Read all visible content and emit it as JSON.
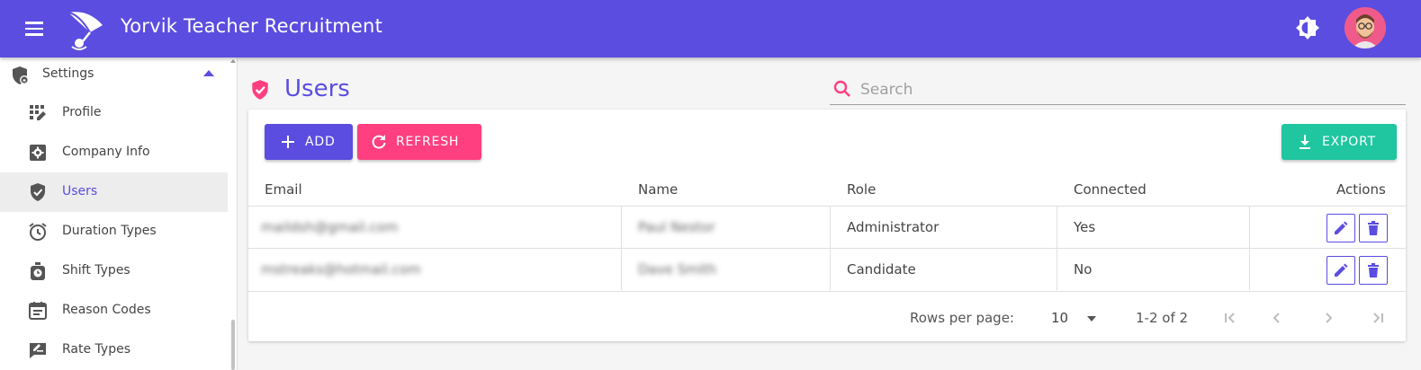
{
  "app": {
    "title": "Yorvik Teacher Recruitment"
  },
  "colors": {
    "primary": "#5b4de0",
    "accent": "#ff3f7f",
    "export": "#1fc6a0"
  },
  "sidebar": {
    "section_label": "Settings",
    "items": [
      {
        "label": "Profile",
        "icon": "profile-grid-icon"
      },
      {
        "label": "Company Info",
        "icon": "gear-box-icon"
      },
      {
        "label": "Users",
        "icon": "shield-check-icon",
        "active": true
      },
      {
        "label": "Duration Types",
        "icon": "alarm-clock-icon"
      },
      {
        "label": "Shift Types",
        "icon": "timer-icon"
      },
      {
        "label": "Reason Codes",
        "icon": "calendar-list-icon"
      },
      {
        "label": "Rate Types",
        "icon": "signature-icon"
      }
    ]
  },
  "page": {
    "title": "Users"
  },
  "search": {
    "placeholder": "Search",
    "value": ""
  },
  "toolbar": {
    "add_label": "ADD",
    "refresh_label": "REFRESH",
    "export_label": "EXPORT"
  },
  "table": {
    "headers": {
      "email": "Email",
      "name": "Name",
      "role": "Role",
      "connected": "Connected",
      "actions": "Actions"
    },
    "rows": [
      {
        "email": "maildsh@gmail.com",
        "name": "Paul Nestor",
        "role": "Administrator",
        "connected": "Yes"
      },
      {
        "email": "mstreaks@hotmail.com",
        "name": "Dave Smith",
        "role": "Candidate",
        "connected": "No"
      }
    ]
  },
  "pagination": {
    "rows_per_page_label": "Rows per page:",
    "rows_per_page": "10",
    "range": "1-2 of 2"
  }
}
